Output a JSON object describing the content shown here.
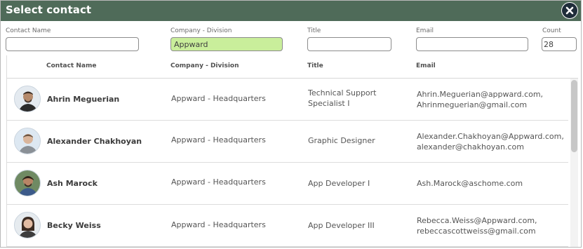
{
  "dialog": {
    "title": "Select contact"
  },
  "filters": {
    "contact_name": {
      "label": "Contact Name",
      "value": ""
    },
    "company_division": {
      "label": "Company - Division",
      "value": "Appward"
    },
    "title": {
      "label": "Title",
      "value": ""
    },
    "email": {
      "label": "Email",
      "value": ""
    },
    "count": {
      "label": "Count",
      "value": "28"
    }
  },
  "table": {
    "headers": {
      "contact_name": "Contact Name",
      "company_division": "Company - Division",
      "title": "Title",
      "email": "Email"
    },
    "rows": [
      {
        "name": "Ahrin Meguerian",
        "company": "Appward - Headquarters",
        "title_line1": "Technical Support",
        "title_line2": "Specialist I",
        "email_line1": "Ahrin.Meguerian@appward.com,",
        "email_line2": "Ahrinmeguerian@gmail.com"
      },
      {
        "name": "Alexander Chakhoyan",
        "company": "Appward - Headquarters",
        "title_line1": "Graphic Designer",
        "title_line2": "",
        "email_line1": "Alexander.Chakhoyan@Appward.com,",
        "email_line2": "alexander@chakhoyan.com"
      },
      {
        "name": "Ash Marock",
        "company": "Appward - Headquarters",
        "title_line1": "App Developer I",
        "title_line2": "",
        "email_line1": "Ash.Marock@aschome.com",
        "email_line2": ""
      },
      {
        "name": "Becky Weiss",
        "company": "Appward - Headquarters",
        "title_line1": "App Developer III",
        "title_line2": "",
        "email_line1": "Rebecca.Weiss@Appward.com,",
        "email_line2": "rebeccascottweiss@gmail.com"
      }
    ]
  },
  "colors": {
    "titlebar": "#4f6b59",
    "active_filter": "#c9ee9b",
    "close_button": "#1f2d3a"
  },
  "icons": {
    "close": "close-icon",
    "avatar": "user-avatar"
  }
}
